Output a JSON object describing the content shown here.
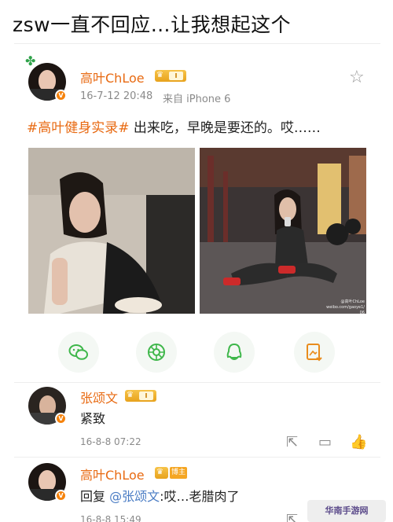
{
  "headline": "zsw一直不回应…让我想起这个",
  "post": {
    "author": "高叶ChLoe",
    "level": "Ⅰ",
    "date": "16-7-12 20:48",
    "source": "来自 iPhone 6",
    "topic": "#高叶健身实录#",
    "text": " 出来吃，早晚是要还的。哎……",
    "photo_caption": "@高叶ChLoe weibo.com/gaoye1/ 06"
  },
  "share_icons": [
    "wechat-icon",
    "moments-icon",
    "qq-icon",
    "save-image-icon"
  ],
  "comments": [
    {
      "author": "张颂文",
      "level": "Ⅰ",
      "text": "紧致",
      "time": "16-8-8 07:22"
    },
    {
      "author": "高叶ChLoe",
      "author_tag": "博主",
      "reply_prefix": "回复 ",
      "mention": "@张颂文",
      "text": ":哎…老腊肉了",
      "time": "16-8-8 15:49"
    }
  ],
  "watermark": "华南手游网"
}
